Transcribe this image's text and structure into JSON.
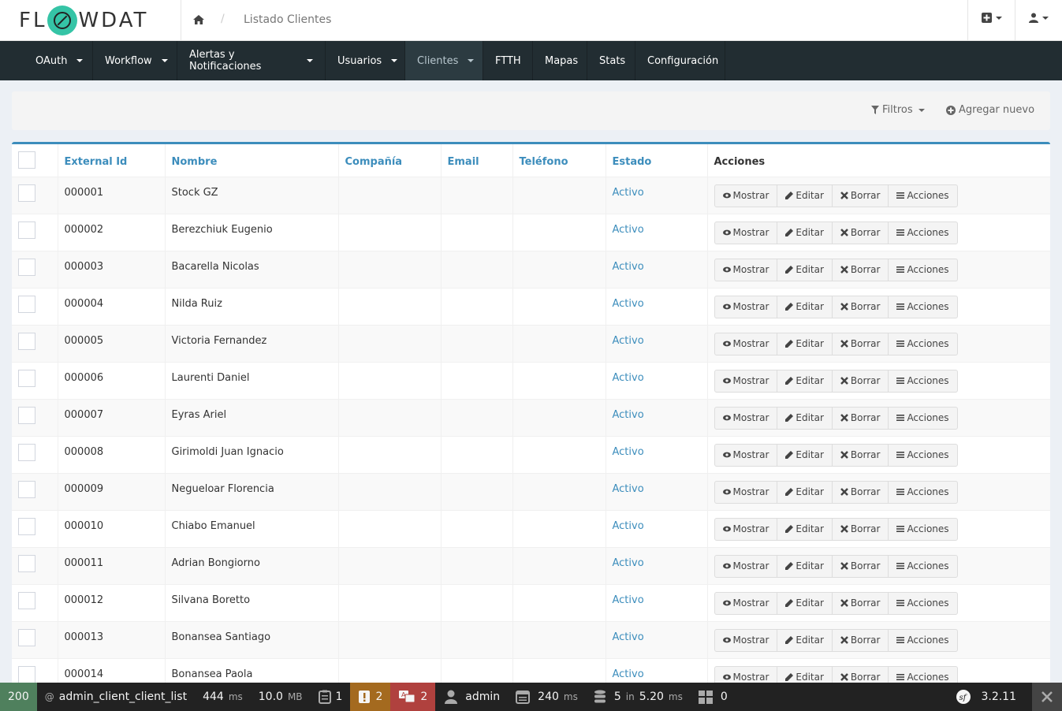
{
  "header": {
    "logo_text_left": "FL",
    "logo_text_right": "WDAT",
    "breadcrumb_separator": "/",
    "breadcrumb_current": "Listado Clientes"
  },
  "nav": {
    "items": [
      {
        "label": "OAuth",
        "dropdown": true
      },
      {
        "label": "Workflow",
        "dropdown": true
      },
      {
        "label": "Alertas y Notificaciones",
        "dropdown": true
      },
      {
        "label": "Usuarios",
        "dropdown": true
      },
      {
        "label": "Clientes",
        "dropdown": true,
        "active": true
      },
      {
        "label": "FTTH",
        "dropdown": false
      },
      {
        "label": "Mapas",
        "dropdown": false
      },
      {
        "label": "Stats",
        "dropdown": false
      },
      {
        "label": "Configuración",
        "dropdown": false
      }
    ]
  },
  "filters": {
    "filter_label": "Filtros",
    "add_label": "Agregar nuevo"
  },
  "table": {
    "columns": [
      "External Id",
      "Nombre",
      "Compañía",
      "Email",
      "Teléfono",
      "Estado",
      "Acciones"
    ],
    "action_labels": [
      "Mostrar",
      "Editar",
      "Borrar",
      "Acciones"
    ],
    "rows": [
      {
        "id": "000001",
        "nombre": "Stock GZ",
        "compania": "",
        "email": "",
        "telefono": "",
        "estado": "Activo"
      },
      {
        "id": "000002",
        "nombre": "Berezchiuk Eugenio",
        "compania": "",
        "email": "",
        "telefono": "",
        "estado": "Activo"
      },
      {
        "id": "000003",
        "nombre": "Bacarella Nicolas",
        "compania": "",
        "email": "",
        "telefono": "",
        "estado": "Activo"
      },
      {
        "id": "000004",
        "nombre": "Nilda Ruiz",
        "compania": "",
        "email": "",
        "telefono": "",
        "estado": "Activo"
      },
      {
        "id": "000005",
        "nombre": "Victoria Fernandez",
        "compania": "",
        "email": "",
        "telefono": "",
        "estado": "Activo"
      },
      {
        "id": "000006",
        "nombre": "Laurenti Daniel",
        "compania": "",
        "email": "",
        "telefono": "",
        "estado": "Activo"
      },
      {
        "id": "000007",
        "nombre": "Eyras Ariel",
        "compania": "",
        "email": "",
        "telefono": "",
        "estado": "Activo"
      },
      {
        "id": "000008",
        "nombre": "Girimoldi Juan Ignacio",
        "compania": "",
        "email": "",
        "telefono": "",
        "estado": "Activo"
      },
      {
        "id": "000009",
        "nombre": "Negueloar Florencia",
        "compania": "",
        "email": "",
        "telefono": "",
        "estado": "Activo"
      },
      {
        "id": "000010",
        "nombre": "Chiabo Emanuel",
        "compania": "",
        "email": "",
        "telefono": "",
        "estado": "Activo"
      },
      {
        "id": "000011",
        "nombre": "Adrian Bongiorno",
        "compania": "",
        "email": "",
        "telefono": "",
        "estado": "Activo"
      },
      {
        "id": "000012",
        "nombre": "Silvana Boretto",
        "compania": "",
        "email": "",
        "telefono": "",
        "estado": "Activo"
      },
      {
        "id": "000013",
        "nombre": "Bonansea Santiago",
        "compania": "",
        "email": "",
        "telefono": "",
        "estado": "Activo"
      },
      {
        "id": "000014",
        "nombre": "Bonansea Paola",
        "compania": "",
        "email": "",
        "telefono": "",
        "estado": "Activo"
      }
    ]
  },
  "toolbar": {
    "status_code": "200",
    "route_prefix": "@",
    "route": "admin_client_client_list",
    "time_value": "444",
    "time_unit": "ms",
    "memory_value": "10.0",
    "memory_unit": "MB",
    "forms_count": "1",
    "warnings_count": "2",
    "translations_count": "2",
    "user": "admin",
    "render_value": "240",
    "render_unit": "ms",
    "db_queries": "5",
    "db_in": "in",
    "db_time": "5.20",
    "db_unit": "ms",
    "twig_count": "0",
    "symfony_version": "3.2.11"
  },
  "colors": {
    "nav_bg": "#222d32",
    "accent": "#3c8dbc",
    "logo_accent": "#35c4a6",
    "status_ok": "#4f805d",
    "warning": "#a46a1f",
    "error": "#b0413e"
  }
}
